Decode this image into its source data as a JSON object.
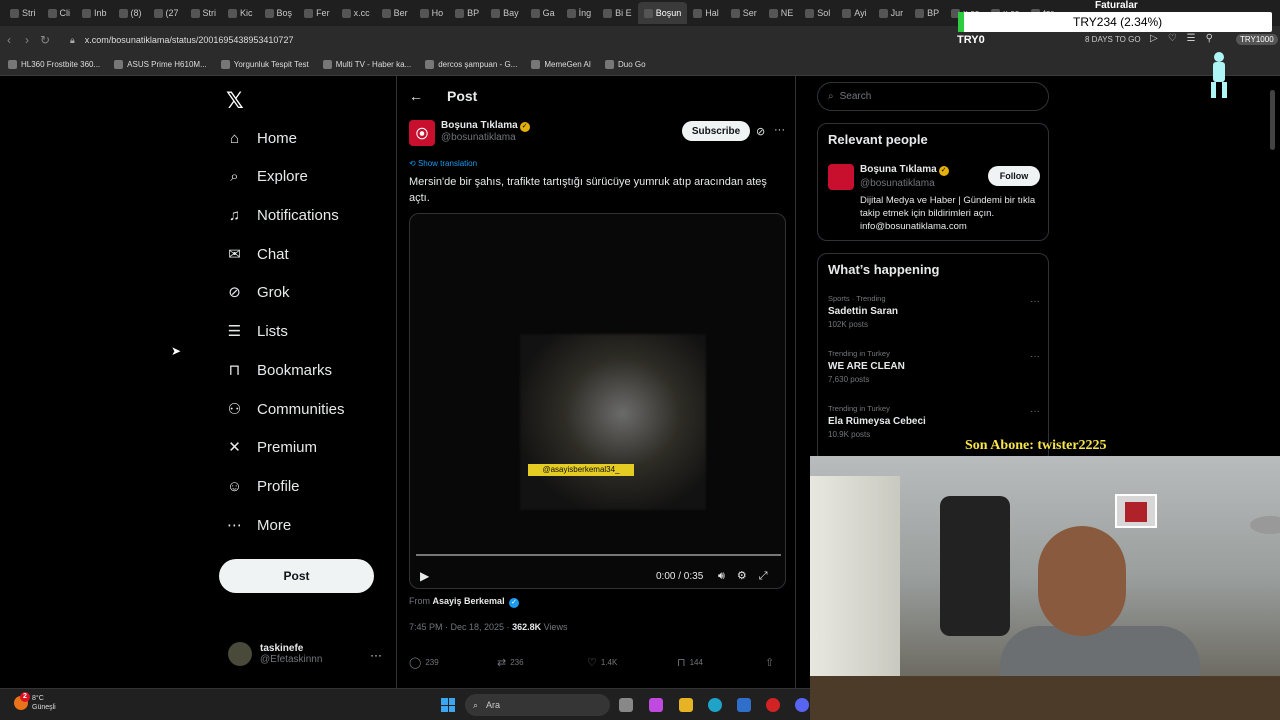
{
  "browser": {
    "tabs": [
      {
        "label": "Stri",
        "icon": "opera-icon"
      },
      {
        "label": "Cli",
        "icon": "chrome-icon"
      },
      {
        "label": "Inb",
        "icon": "gmail-icon"
      },
      {
        "label": "(8)",
        "icon": "instagram-icon"
      },
      {
        "label": "(27",
        "icon": "chat-icon"
      },
      {
        "label": "Stri",
        "icon": "k-icon"
      },
      {
        "label": "Kic",
        "icon": "x-icon"
      },
      {
        "label": "Boş",
        "icon": "x-icon"
      },
      {
        "label": "Fer",
        "icon": "youtube-icon"
      },
      {
        "label": "x.cc",
        "icon": "x-icon"
      },
      {
        "label": "Ber",
        "icon": "x-icon"
      },
      {
        "label": "Ho",
        "icon": "x-icon"
      },
      {
        "label": "BP",
        "icon": "x-icon"
      },
      {
        "label": "Bay",
        "icon": "x-icon"
      },
      {
        "label": "Ga",
        "icon": "x-icon"
      },
      {
        "label": "İng",
        "icon": "x-icon"
      },
      {
        "label": "Bi E",
        "icon": "x-icon"
      },
      {
        "label": "Boşun",
        "icon": "x-icon"
      },
      {
        "label": "Hal",
        "icon": "x-icon"
      },
      {
        "label": "Ser",
        "icon": "x-icon"
      },
      {
        "label": "NE",
        "icon": "x-icon"
      },
      {
        "label": "Sol",
        "icon": "x-icon"
      },
      {
        "label": "Ayi",
        "icon": "x-icon"
      },
      {
        "label": "Jur",
        "icon": "x-icon"
      },
      {
        "label": "BP",
        "icon": "x-icon"
      },
      {
        "label": "x.cc",
        "icon": "x-icon"
      },
      {
        "label": "x.cc",
        "icon": "x-icon"
      },
      {
        "label": "tar",
        "icon": "x-icon"
      }
    ],
    "active_tab": 17,
    "url": "x.com/bosunatiklama/status/2001695438953410727",
    "bookmarks": [
      {
        "label": "HL360 Frostbite 360..."
      },
      {
        "label": "ASUS Prime H610M..."
      },
      {
        "label": "Yorgunluk Tespit Test"
      },
      {
        "label": "Multi TV - Haber ka..."
      },
      {
        "label": "dercos şampuan - G..."
      },
      {
        "label": "MemeGen AI"
      },
      {
        "label": "Duo Go"
      }
    ]
  },
  "stream_overlay": {
    "faturalar": "Faturalar",
    "try_bar": "TRY234 (2.34%)",
    "try0": "TRY0",
    "days_to_go": "8 DAYS TO GO",
    "tag": "TRY1000",
    "son_abone": "Son Abone: twister2225"
  },
  "nav": {
    "items": [
      {
        "label": "Home",
        "icon": "home-icon",
        "glyph": "⌂"
      },
      {
        "label": "Explore",
        "icon": "search-icon",
        "glyph": "⌕"
      },
      {
        "label": "Notifications",
        "icon": "bell-icon",
        "glyph": "♫"
      },
      {
        "label": "Chat",
        "icon": "envelope-icon",
        "glyph": "✉"
      },
      {
        "label": "Grok",
        "icon": "grok-icon",
        "glyph": "⊘"
      },
      {
        "label": "Lists",
        "icon": "list-icon",
        "glyph": "☰"
      },
      {
        "label": "Bookmarks",
        "icon": "bookmark-icon",
        "glyph": "⊓"
      },
      {
        "label": "Communities",
        "icon": "communities-icon",
        "glyph": "⚇"
      },
      {
        "label": "Premium",
        "icon": "x-premium-icon",
        "glyph": "✕"
      },
      {
        "label": "Profile",
        "icon": "person-icon",
        "glyph": "☺"
      },
      {
        "label": "More",
        "icon": "more-circle-icon",
        "glyph": "⋯"
      }
    ],
    "post_button": "Post",
    "user": {
      "name": "taskinefe",
      "handle": "@Efetaskinnn"
    }
  },
  "post": {
    "header_title": "Post",
    "author_name": "Boşuna Tıklama",
    "author_handle": "@bosunatiklama",
    "subscribe": "Subscribe",
    "show_translation": "Show translation",
    "text": "Mersin'de bir şahıs, trafikte tartıştığı sürücüye yumruk atıp aracından ateş açtı.",
    "video": {
      "watermark": "@asayisberkemal34_",
      "time": "0:00 / 0:35",
      "progress": 0
    },
    "from_label": "From",
    "from_name": "Asayiş Berkemal",
    "timestamp": "7:45 PM · Dec 18, 2025 · ",
    "views_count": "362.8K",
    "views_label": " Views",
    "replies": "239",
    "reposts": "236",
    "likes": "1.4K",
    "bookmarks": "144"
  },
  "sidebar": {
    "search_placeholder": "Search",
    "relevant_title": "Relevant people",
    "person": {
      "name": "Boşuna Tıklama",
      "handle": "@bosunatiklama",
      "follow": "Follow",
      "bio": "Dijital Medya ve Haber | Gündemi bir tıkla takip etmek için bildirimleri açın. info@bosunatiklama.com"
    },
    "happening_title": "What’s happening",
    "trends": [
      {
        "context": "Sports · Trending",
        "name": "Sadettin Saran",
        "posts": "102K posts"
      },
      {
        "context": "Trending in Turkey",
        "name": "WE ARE CLEAN",
        "posts": "7,630 posts"
      },
      {
        "context": "Trending in Turkey",
        "name": "Ela Rümeysa Cebeci",
        "posts": "10.9K posts"
      }
    ]
  },
  "taskbar": {
    "weather_temp": "8°C",
    "weather_place": "Güneşli",
    "weather_badge": "2",
    "search_placeholder": "Ara"
  },
  "colors": {
    "accent": "#1d9bf0",
    "brand_red": "#c8102e",
    "verified_gold": "#e4b10c",
    "overlay_yellow": "#f7e54a"
  }
}
